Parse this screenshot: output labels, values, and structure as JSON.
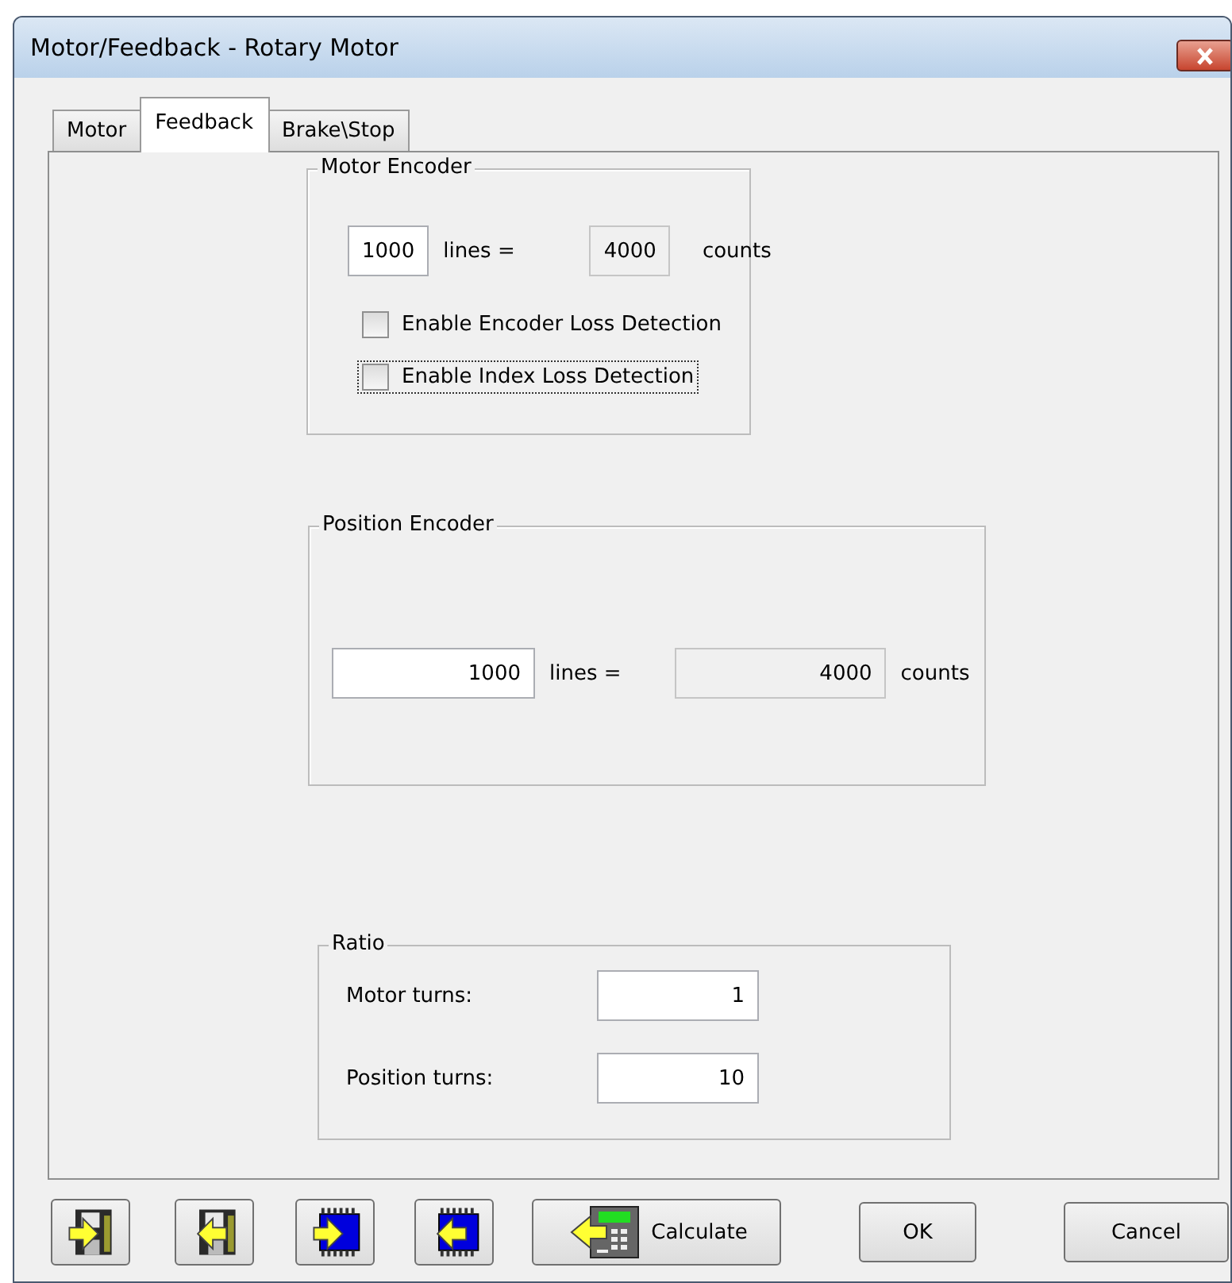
{
  "window": {
    "title": "Motor/Feedback - Rotary Motor"
  },
  "tabs": [
    {
      "label": "Motor",
      "selected": false
    },
    {
      "label": "Feedback",
      "selected": true
    },
    {
      "label": "Brake\\Stop",
      "selected": false
    }
  ],
  "motor_encoder": {
    "title": "Motor Encoder",
    "lines": "1000",
    "lines_label": "lines  =",
    "counts": "4000",
    "counts_label": "counts",
    "checkboxes": [
      {
        "label": "Enable Encoder Loss Detection",
        "checked": false,
        "focused": false
      },
      {
        "label": "Enable Index Loss Detection",
        "checked": false,
        "focused": true
      }
    ]
  },
  "position_encoder": {
    "title": "Position Encoder",
    "lines": "1000",
    "lines_label": "lines  =",
    "counts": "4000",
    "counts_label": "counts"
  },
  "ratio": {
    "title": "Ratio",
    "rows": [
      {
        "label": "Motor turns:",
        "value": "1"
      },
      {
        "label": "Position turns:",
        "value": "10"
      }
    ]
  },
  "buttons": [
    {
      "kind": "disk_in"
    },
    {
      "kind": "disk_out"
    },
    {
      "kind": "chip_in"
    },
    {
      "kind": "chip_out"
    },
    {
      "kind": "calc",
      "label": "Calculate"
    },
    {
      "kind": "text",
      "label": "OK"
    },
    {
      "kind": "text",
      "label": "Cancel"
    }
  ]
}
